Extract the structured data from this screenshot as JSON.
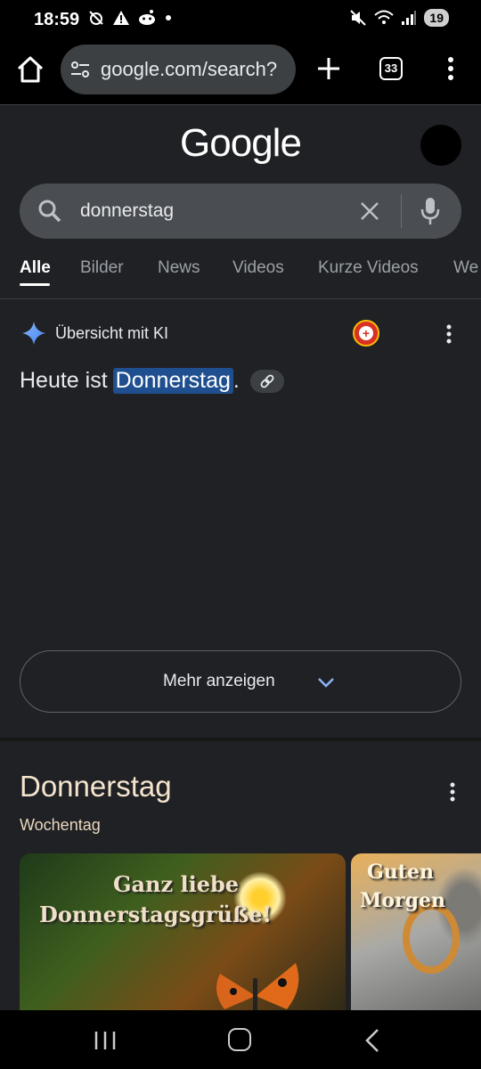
{
  "status_bar": {
    "time": "18:59",
    "battery": "19",
    "left_icons": [
      "alarm-off-icon",
      "warning-icon",
      "reddit-icon",
      "dot-icon"
    ],
    "right_icons": [
      "mute-icon",
      "wifi-icon",
      "signal-icon"
    ]
  },
  "browser": {
    "url": "google.com/search?",
    "tab_count": "33"
  },
  "google": {
    "logo": "Google",
    "search_query": "donnerstag"
  },
  "tabs": [
    "Alle",
    "Bilder",
    "News",
    "Videos",
    "Kurze Videos",
    "We"
  ],
  "ai_overview": {
    "title": "Übersicht mit KI",
    "answer_prefix": "Heute ist",
    "answer_highlight": "Donnerstag",
    "answer_suffix": ".",
    "more_button": "Mehr anzeigen"
  },
  "knowledge_panel": {
    "title": "Donnerstag",
    "subtitle": "Wochentag",
    "images": [
      {
        "line1": "Ganz liebe",
        "line2": "Donnerstagsgrüße!"
      },
      {
        "line1": "Guten",
        "line2": "Morgen"
      }
    ]
  }
}
